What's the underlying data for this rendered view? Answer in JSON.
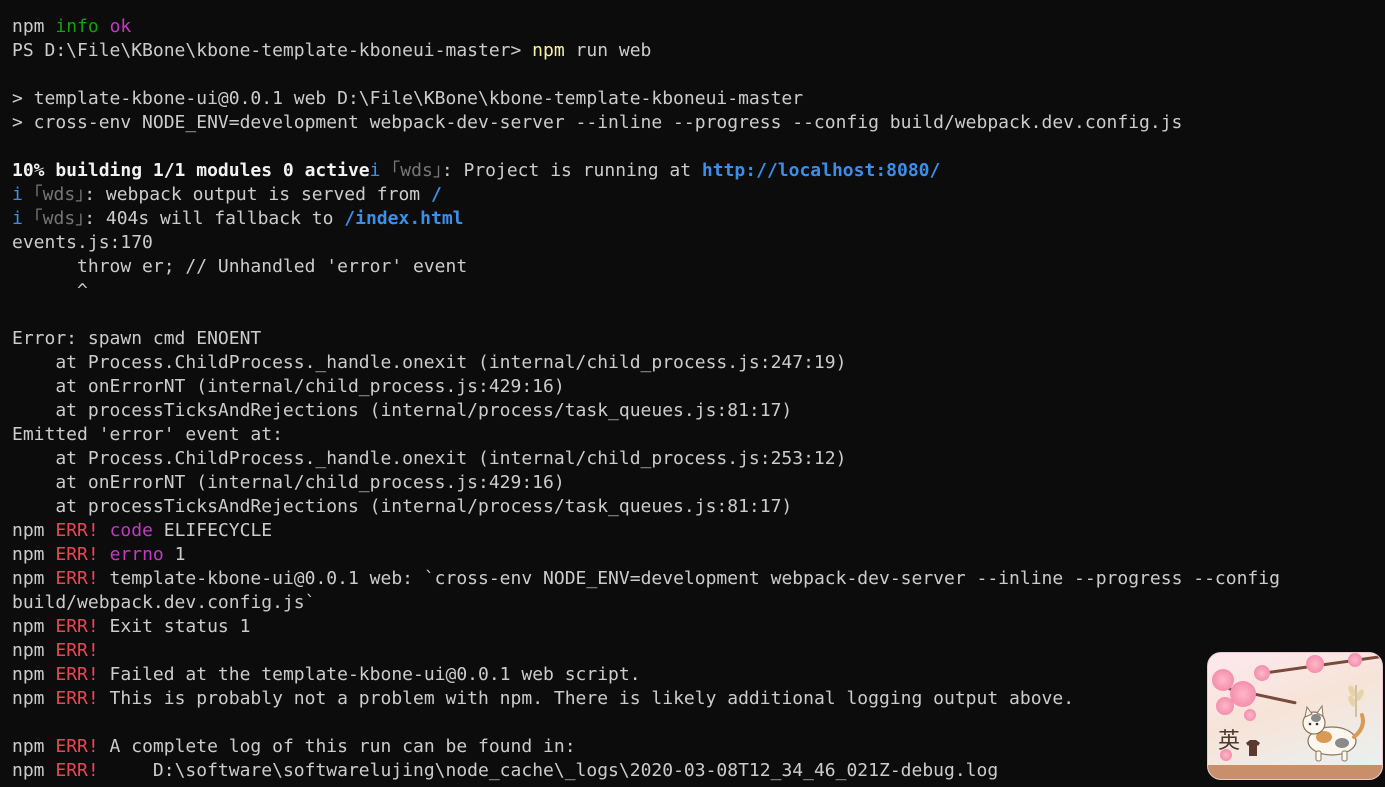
{
  "terminal": {
    "npm_info": {
      "prefix": "npm ",
      "info": "info",
      "ok": "ok"
    },
    "prompt": {
      "ps": "PS D:\\File\\KBone\\kbone-template-kboneui-master> ",
      "cmd": "npm",
      "args": " run web"
    },
    "script_header": [
      "> template-kbone-ui@0.0.1 web D:\\File\\KBone\\kbone-template-kboneui-master",
      "> cross-env NODE_ENV=development webpack-dev-server --inline --progress --config build/webpack.dev.config.js"
    ],
    "progress": {
      "bold": "10% building 1/1 modules 0 active",
      "i": "i",
      "wds": " ｢wds｣",
      "text": ": Project is running at ",
      "url": "http://localhost:8080/"
    },
    "wds_lines": [
      {
        "i": "i",
        "wds": " ｢wds｣",
        "text": ": webpack output is served from ",
        "link": "/"
      },
      {
        "i": "i",
        "wds": " ｢wds｣",
        "text": ": 404s will fallback to ",
        "link": "/index.html"
      }
    ],
    "stack": [
      "events.js:170",
      "      throw er; // Unhandled 'error' event",
      "      ^",
      "",
      "Error: spawn cmd ENOENT",
      "    at Process.ChildProcess._handle.onexit (internal/child_process.js:247:19)",
      "    at onErrorNT (internal/child_process.js:429:16)",
      "    at processTicksAndRejections (internal/process/task_queues.js:81:17)",
      "Emitted 'error' event at:",
      "    at Process.ChildProcess._handle.onexit (internal/child_process.js:253:12)",
      "    at onErrorNT (internal/child_process.js:429:16)",
      "    at processTicksAndRejections (internal/process/task_queues.js:81:17)"
    ],
    "err_prefix": "npm ",
    "err_tag": "ERR!",
    "err_lines": [
      {
        "key": "code",
        "text": " ELIFECYCLE"
      },
      {
        "key": "errno",
        "text": " 1"
      },
      {
        "key": "",
        "text": " template-kbone-ui@0.0.1 web: `cross-env NODE_ENV=development webpack-dev-server --inline --progress --config"
      }
    ],
    "wrapped": "build/webpack.dev.config.js`",
    "err_lines_2": [
      " Exit status 1",
      "",
      " Failed at the template-kbone-ui@0.0.1 web script.",
      " This is probably not a problem with npm. There is likely additional logging output above."
    ],
    "err_lines_3": [
      " A complete log of this run can be found in:",
      "     D:\\software\\softwarelujing\\node_cache\\_logs\\2020-03-08T12_34_46_021Z-debug.log"
    ]
  },
  "ime": {
    "char": "英",
    "icon": "ime-skin-cat-blossom"
  },
  "colors": {
    "background": "#0c0c0c",
    "text": "#cccccc",
    "green": "#13a10e",
    "magenta": "#c239c4",
    "yellow": "#f9f1a5",
    "blue": "#3b8eea",
    "red": "#e74856"
  }
}
